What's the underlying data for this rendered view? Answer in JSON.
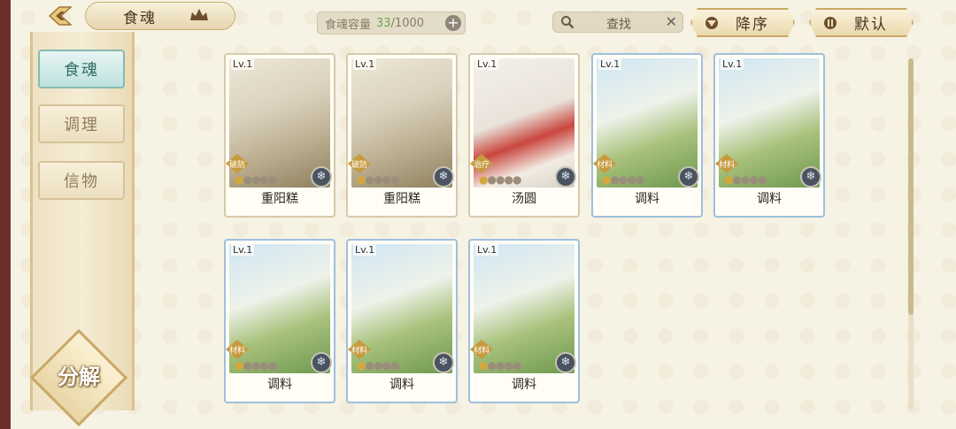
{
  "header": {
    "title": "食魂",
    "capacity_label": "食魂容量",
    "capacity_current": "33",
    "capacity_total": "/1000",
    "capacity_add": "+",
    "search_placeholder": "查找",
    "search_clear": "✕",
    "sort_desc": "降序",
    "sort_default": "默认"
  },
  "sidebar": {
    "tabs": [
      {
        "label": "食魂",
        "active": true
      },
      {
        "label": "调理",
        "active": false
      },
      {
        "label": "信物",
        "active": false
      }
    ],
    "decompose_label": "分解"
  },
  "cards": [
    {
      "level": "Lv.1",
      "role": "破防",
      "name": "重阳糕",
      "stars_lit": 1,
      "icons": "warrior"
    },
    {
      "level": "Lv.1",
      "role": "破防",
      "name": "重阳糕",
      "stars_lit": 1,
      "icons": "warrior"
    },
    {
      "level": "Lv.1",
      "role": "治疗",
      "name": "汤圆",
      "stars_lit": 1,
      "icons": "healer"
    },
    {
      "level": "Lv.1",
      "role": "材料",
      "name": "调料",
      "stars_lit": 1,
      "icons": "material"
    },
    {
      "level": "Lv.1",
      "role": "材料",
      "name": "调料",
      "stars_lit": 1,
      "icons": "material"
    },
    {
      "level": "Lv.1",
      "role": "材料",
      "name": "调料",
      "stars_lit": 1,
      "icons": "material"
    },
    {
      "level": "Lv.1",
      "role": "材料",
      "name": "调料",
      "stars_lit": 1,
      "icons": "material"
    },
    {
      "level": "Lv.1",
      "role": "材料",
      "name": "调料",
      "stars_lit": 1,
      "icons": "material"
    }
  ],
  "colors": {
    "accent_gold": "#c9a866",
    "active_tab": "#bfe2de",
    "capacity_current": "#6fa54e"
  }
}
